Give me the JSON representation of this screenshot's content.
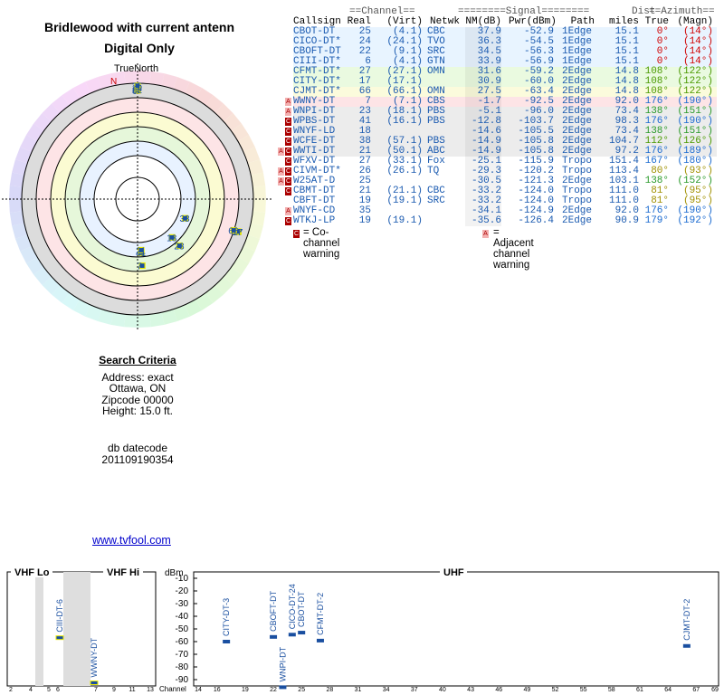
{
  "header": {
    "title": "Bridlewood with current antenn",
    "subtitle": "Digital Only"
  },
  "search_criteria": {
    "heading": "Search Criteria",
    "address": "Address: exact",
    "city": "Ottawa, ON",
    "zip": "Zipcode 00000",
    "height": "Height: 15.0 ft.",
    "db_label": "db datecode",
    "db_value": "201109190354"
  },
  "link": {
    "text": "www.tvfool.com"
  },
  "table": {
    "header_top": [
      "==Channel==",
      "========Signal========",
      "Dist",
      "==Azimuth=="
    ],
    "columns": [
      "Callsign",
      "Real",
      "(Virt)",
      "Netwk",
      "NM(dB)",
      "Pwr(dBm)",
      "Path",
      "miles",
      "True",
      "(Magn)"
    ],
    "rows": [
      {
        "callsign": "CBOT-DT",
        "real": "25",
        "virt": "(4.1)",
        "netwk": "CBC",
        "nm": "37.9",
        "pwr": "-52.9",
        "path": "1Edge",
        "dist": "15.1",
        "true": "0°",
        "magn": "(14°)",
        "flag": "",
        "bg": "#e8f4ff",
        "az_color": "#d00000"
      },
      {
        "callsign": "CICO-DT*",
        "real": "24",
        "virt": "(24.1)",
        "netwk": "TVO",
        "nm": "36.3",
        "pwr": "-54.5",
        "path": "1Edge",
        "dist": "15.1",
        "true": "0°",
        "magn": "(14°)",
        "flag": "",
        "bg": "#e8f4ff",
        "az_color": "#d00000"
      },
      {
        "callsign": "CBOFT-DT",
        "real": "22",
        "virt": "(9.1)",
        "netwk": "SRC",
        "nm": "34.5",
        "pwr": "-56.3",
        "path": "1Edge",
        "dist": "15.1",
        "true": "0°",
        "magn": "(14°)",
        "flag": "",
        "bg": "#e8f4ff",
        "az_color": "#d00000"
      },
      {
        "callsign": "CIII-DT*",
        "real": "6",
        "virt": "(4.1)",
        "netwk": "GTN",
        "nm": "33.9",
        "pwr": "-56.9",
        "path": "1Edge",
        "dist": "15.1",
        "true": "0°",
        "magn": "(14°)",
        "flag": "",
        "bg": "#e8f4ff",
        "az_color": "#d00000"
      },
      {
        "callsign": "CFMT-DT*",
        "real": "27",
        "virt": "(27.1)",
        "netwk": "OMN",
        "nm": "31.6",
        "pwr": "-59.2",
        "path": "2Edge",
        "dist": "14.8",
        "true": "108°",
        "magn": "(122°)",
        "flag": "",
        "bg": "#eafae0",
        "az_color": "#4a9a00"
      },
      {
        "callsign": "CITY-DT*",
        "real": "17",
        "virt": "(17.1)",
        "netwk": "",
        "nm": "30.9",
        "pwr": "-60.0",
        "path": "2Edge",
        "dist": "14.8",
        "true": "108°",
        "magn": "(122°)",
        "flag": "",
        "bg": "#eafae0",
        "az_color": "#4a9a00"
      },
      {
        "callsign": "CJMT-DT*",
        "real": "66",
        "virt": "(66.1)",
        "netwk": "OMN",
        "nm": "27.5",
        "pwr": "-63.4",
        "path": "2Edge",
        "dist": "14.8",
        "true": "108°",
        "magn": "(122°)",
        "flag": "",
        "bg": "#fbfbdc",
        "az_color": "#4a9a00"
      },
      {
        "callsign": "WWNY-DT",
        "real": "7",
        "virt": "(7.1)",
        "netwk": "CBS",
        "nm": "-1.7",
        "pwr": "-92.5",
        "path": "2Edge",
        "dist": "92.0",
        "true": "176°",
        "magn": "(190°)",
        "flag": "A",
        "bg": "#fde4e6",
        "az_color": "#1a6ad0"
      },
      {
        "callsign": "WNPI-DT",
        "real": "23",
        "virt": "(18.1)",
        "netwk": "PBS",
        "nm": "-5.1",
        "pwr": "-96.0",
        "path": "2Edge",
        "dist": "73.4",
        "true": "138°",
        "magn": "(151°)",
        "flag": "A",
        "bg": "#ececec",
        "az_color": "#2a9a2a"
      },
      {
        "callsign": "WPBS-DT",
        "real": "41",
        "virt": "(16.1)",
        "netwk": "PBS",
        "nm": "-12.8",
        "pwr": "-103.7",
        "path": "2Edge",
        "dist": "98.3",
        "true": "176°",
        "magn": "(190°)",
        "flag": "C",
        "bg": "#ececec",
        "az_color": "#1a6ad0"
      },
      {
        "callsign": "WNYF-LD",
        "real": "18",
        "virt": "",
        "netwk": "",
        "nm": "-14.6",
        "pwr": "-105.5",
        "path": "2Edge",
        "dist": "73.4",
        "true": "138°",
        "magn": "(151°)",
        "flag": "C",
        "bg": "#ececec",
        "az_color": "#2a9a2a"
      },
      {
        "callsign": "WCFE-DT",
        "real": "38",
        "virt": "(57.1)",
        "netwk": "PBS",
        "nm": "-14.9",
        "pwr": "-105.8",
        "path": "2Edge",
        "dist": "104.7",
        "true": "112°",
        "magn": "(126°)",
        "flag": "C",
        "bg": "#ececec",
        "az_color": "#4a9a00"
      },
      {
        "callsign": "WWTI-DT",
        "real": "21",
        "virt": "(50.1)",
        "netwk": "ABC",
        "nm": "-14.9",
        "pwr": "-105.8",
        "path": "2Edge",
        "dist": "97.2",
        "true": "176°",
        "magn": "(189°)",
        "flag": "AC",
        "bg": "#ececec",
        "az_color": "#1a6ad0"
      },
      {
        "callsign": "WFXV-DT",
        "real": "27",
        "virt": "(33.1)",
        "netwk": "Fox",
        "nm": "-25.1",
        "pwr": "-115.9",
        "path": "Tropo",
        "dist": "151.4",
        "true": "167°",
        "magn": "(180°)",
        "flag": "C",
        "bg": "#ffffff",
        "az_color": "#1a6ad0"
      },
      {
        "callsign": "CIVM-DT*",
        "real": "26",
        "virt": "(26.1)",
        "netwk": "TQ",
        "nm": "-29.3",
        "pwr": "-120.2",
        "path": "Tropo",
        "dist": "113.4",
        "true": "80°",
        "magn": "(93°)",
        "flag": "AC",
        "bg": "#ffffff",
        "az_color": "#a09000"
      },
      {
        "callsign": "W25AT-D",
        "real": "25",
        "virt": "",
        "netwk": "",
        "nm": "-30.5",
        "pwr": "-121.3",
        "path": "2Edge",
        "dist": "103.1",
        "true": "138°",
        "magn": "(152°)",
        "flag": "AC",
        "bg": "#ffffff",
        "az_color": "#2a9a2a"
      },
      {
        "callsign": "CBMT-DT",
        "real": "21",
        "virt": "(21.1)",
        "netwk": "CBC",
        "nm": "-33.2",
        "pwr": "-124.0",
        "path": "Tropo",
        "dist": "111.0",
        "true": "81°",
        "magn": "(95°)",
        "flag": "C",
        "bg": "#ffffff",
        "az_color": "#a09000"
      },
      {
        "callsign": "CBFT-DT",
        "real": "19",
        "virt": "(19.1)",
        "netwk": "SRC",
        "nm": "-33.2",
        "pwr": "-124.0",
        "path": "Tropo",
        "dist": "111.0",
        "true": "81°",
        "magn": "(95°)",
        "flag": "",
        "bg": "#ffffff",
        "az_color": "#a09000"
      },
      {
        "callsign": "WNYF-CD",
        "real": "35",
        "virt": "",
        "netwk": "",
        "nm": "-34.1",
        "pwr": "-124.9",
        "path": "2Edge",
        "dist": "92.0",
        "true": "176°",
        "magn": "(190°)",
        "flag": "A",
        "bg": "#ffffff",
        "az_color": "#1a6ad0"
      },
      {
        "callsign": "WTKJ-LP",
        "real": "19",
        "virt": "(19.1)",
        "netwk": "",
        "nm": "-35.6",
        "pwr": "-126.4",
        "path": "2Edge",
        "dist": "90.9",
        "true": "179°",
        "magn": "(192°)",
        "flag": "C",
        "bg": "#ffffff",
        "az_color": "#1a6ad0"
      }
    ],
    "legend_co": "= Co-channel warning",
    "legend_adj": "= Adjacent channel warning",
    "flag_c": "C",
    "flag_a": "A"
  },
  "chart_data": [
    {
      "type": "scatter",
      "title": "",
      "polar": true,
      "north_label": "TrueNorth",
      "n_label": "N",
      "points": [
        {
          "label": "6",
          "azimuth": 0,
          "nm": 33.9
        },
        {
          "label": "22",
          "azimuth": 0,
          "nm": 34.5
        },
        {
          "label": "24",
          "azimuth": 0,
          "nm": 36.3
        },
        {
          "label": "25",
          "azimuth": 0,
          "nm": 37.9
        },
        {
          "label": "27",
          "azimuth": 108,
          "nm": 31.6
        },
        {
          "label": "17",
          "azimuth": 108,
          "nm": 30.9
        },
        {
          "label": "66",
          "azimuth": 108,
          "nm": 27.5
        },
        {
          "label": "38",
          "azimuth": 112,
          "nm": -14.9
        },
        {
          "label": "23",
          "azimuth": 138,
          "nm": -5.1
        },
        {
          "label": "18",
          "azimuth": 138,
          "nm": -14.6
        },
        {
          "label": "7",
          "azimuth": 176,
          "nm": -1.7
        },
        {
          "label": "41",
          "azimuth": 176,
          "nm": -12.8
        },
        {
          "label": "21",
          "azimuth": 176,
          "nm": -14.9
        }
      ]
    },
    {
      "type": "bar",
      "title": "",
      "ylabel": "dBm",
      "xlabel": "Channel",
      "ylim": [
        -95,
        -5
      ],
      "yticks": [
        -10,
        -20,
        -30,
        -40,
        -50,
        -60,
        -70,
        -80,
        -90
      ],
      "bands": [
        {
          "name": "VHF Lo"
        },
        {
          "name": "VHF Hi"
        },
        {
          "name": "UHF"
        }
      ],
      "x_ticks_lo": [
        "2",
        "4",
        "5",
        "6"
      ],
      "x_ticks_hi": [
        "7",
        "9",
        "11",
        "13"
      ],
      "x_ticks_uhf": [
        "14",
        "16",
        "19",
        "22",
        "25",
        "28",
        "31",
        "34",
        "37",
        "40",
        "43",
        "46",
        "49",
        "52",
        "55",
        "58",
        "61",
        "64",
        "67",
        "69"
      ],
      "stations": [
        {
          "label": "CIII-DT-6",
          "channel": 6,
          "pwr": -56.9
        },
        {
          "label": "WWNY-DT",
          "channel": 7,
          "pwr": -92.5
        },
        {
          "label": "CITY-DT-3",
          "channel": 17,
          "pwr": -60.0
        },
        {
          "label": "CBOFT-DT",
          "channel": 22,
          "pwr": -56.3
        },
        {
          "label": "WNPI-DT",
          "channel": 23,
          "pwr": -96.0
        },
        {
          "label": "CICO-DT-24",
          "channel": 24,
          "pwr": -54.5
        },
        {
          "label": "CBOT-DT",
          "channel": 25,
          "pwr": -52.9
        },
        {
          "label": "CFMT-DT-2",
          "channel": 27,
          "pwr": -59.2
        },
        {
          "label": "CJMT-DT-2",
          "channel": 66,
          "pwr": -63.4
        }
      ]
    }
  ]
}
